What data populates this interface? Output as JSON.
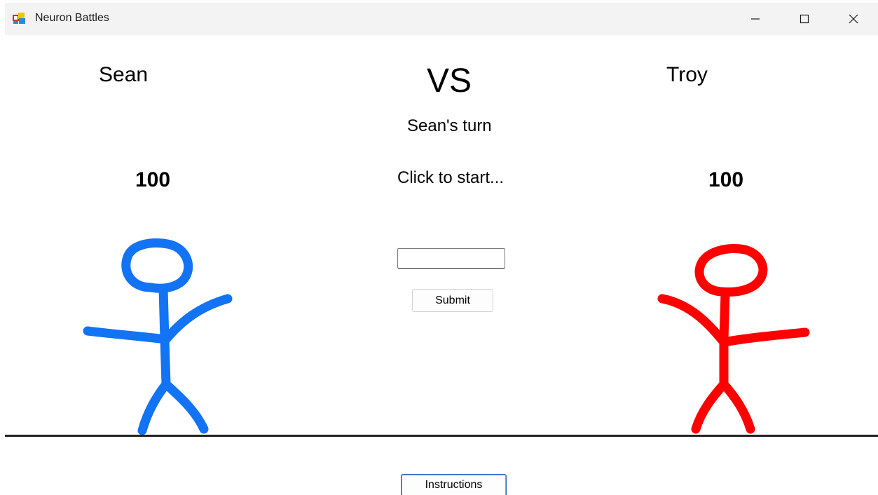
{
  "window": {
    "title": "Neuron Battles"
  },
  "players": {
    "left": {
      "name": "Sean",
      "hp": "100",
      "color": "#1273f5"
    },
    "right": {
      "name": "Troy",
      "hp": "100",
      "color": "#ff0000"
    }
  },
  "center": {
    "vs_label": "VS",
    "turn_text": "Sean's turn",
    "status_text": "Click to start...",
    "answer_value": "",
    "submit_label": "Submit"
  },
  "footer": {
    "instructions_label": "Instructions"
  }
}
